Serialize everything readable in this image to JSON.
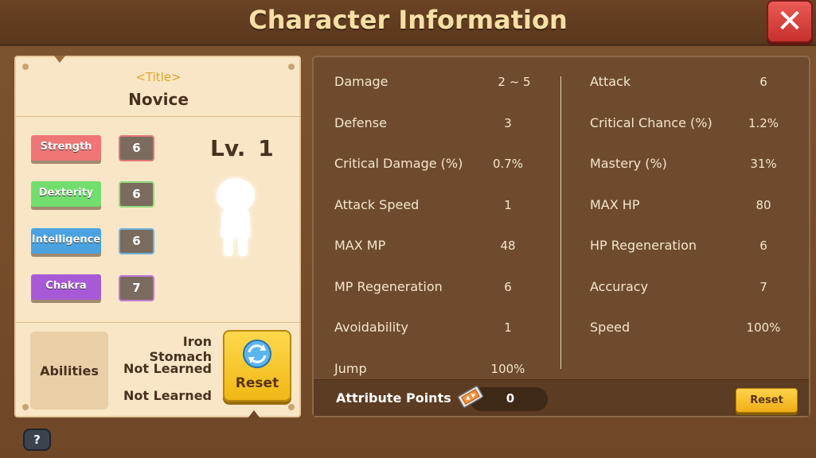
{
  "window": {
    "title": "Character Information",
    "close_label": "✕"
  },
  "profile": {
    "title": "<Title>",
    "job": "Novice",
    "level_prefix": "Lv.",
    "level": "1"
  },
  "base_stats": [
    {
      "label": "Strength",
      "value": "6",
      "color": "#ee7676"
    },
    {
      "label": "Dexterity",
      "value": "6",
      "color": "#72de6e"
    },
    {
      "label": "Intelligence",
      "value": "6",
      "color": "#4aa3e0"
    },
    {
      "label": "Chakra",
      "value": "7",
      "color": "#a85ad6"
    }
  ],
  "abilities": {
    "label": "Abilities",
    "items": [
      "Iron Stomach",
      "Not Learned",
      "Not Learned"
    ],
    "reset_label": "Reset"
  },
  "details_left": [
    {
      "name": "Damage",
      "value": "2 ~ 5"
    },
    {
      "name": "Defense",
      "value": "3"
    },
    {
      "name": "Critical Damage (%)",
      "value": "0.7%"
    },
    {
      "name": "Attack Speed",
      "value": "1"
    },
    {
      "name": "MAX MP",
      "value": "48"
    },
    {
      "name": "MP Regeneration",
      "value": "6"
    },
    {
      "name": "Avoidability",
      "value": "1"
    },
    {
      "name": "Jump",
      "value": "100%"
    }
  ],
  "details_right": [
    {
      "name": "Attack",
      "value": "6"
    },
    {
      "name": "Critical Chance (%)",
      "value": "1.2%"
    },
    {
      "name": "Mastery (%)",
      "value": "31%"
    },
    {
      "name": "MAX HP",
      "value": "80"
    },
    {
      "name": "HP Regeneration",
      "value": "6"
    },
    {
      "name": "Accuracy",
      "value": "7"
    },
    {
      "name": "Speed",
      "value": "100%"
    }
  ],
  "attribute_points": {
    "label": "Attribute Points",
    "value": "0",
    "reset_label": "Reset"
  },
  "help": {
    "label": "?"
  }
}
